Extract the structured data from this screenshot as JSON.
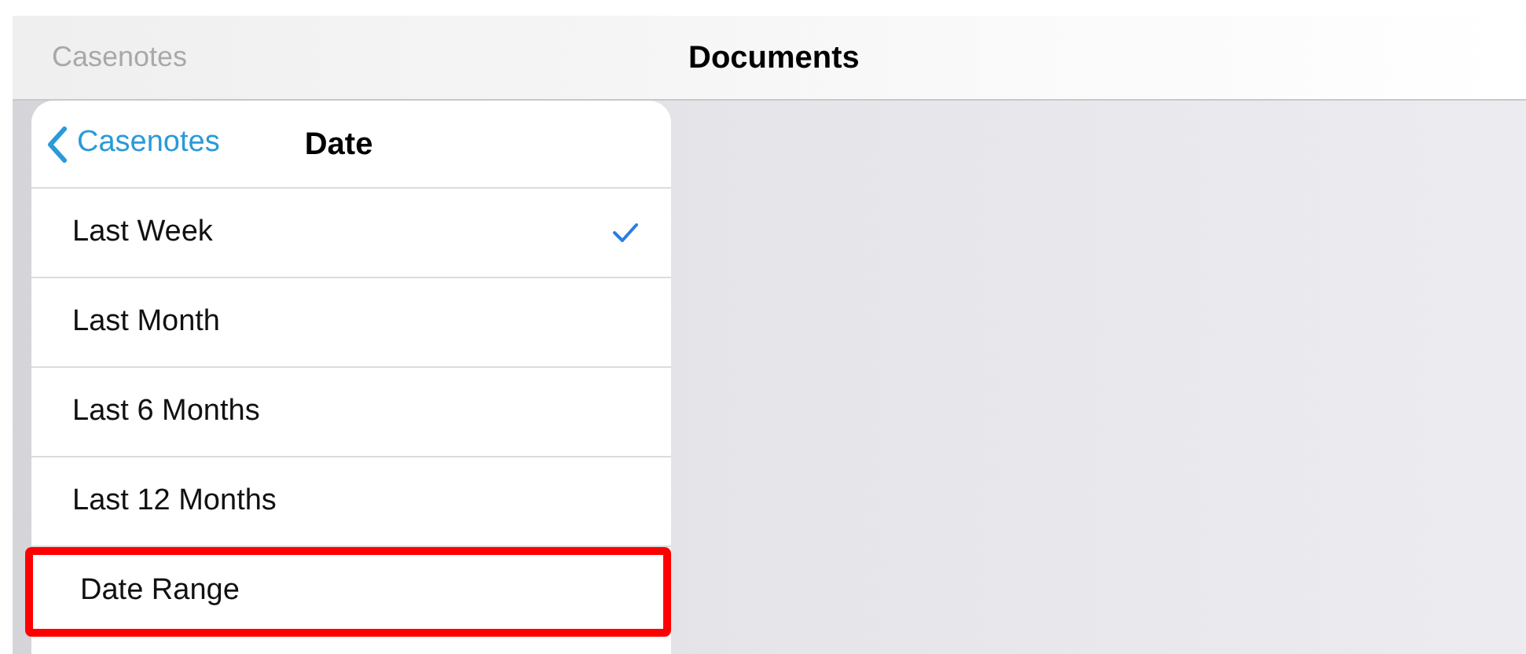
{
  "nav_bar": {
    "back_label": "Casenotes",
    "title": "Documents"
  },
  "popover": {
    "back_label": "Casenotes",
    "title": "Date",
    "items": [
      {
        "label": "Last Week",
        "selected": true,
        "highlighted": false
      },
      {
        "label": "Last Month",
        "selected": false,
        "highlighted": false
      },
      {
        "label": "Last 6 Months",
        "selected": false,
        "highlighted": false
      },
      {
        "label": "Last 12 Months",
        "selected": false,
        "highlighted": false
      },
      {
        "label": "Date Range",
        "selected": false,
        "highlighted": true
      }
    ]
  }
}
